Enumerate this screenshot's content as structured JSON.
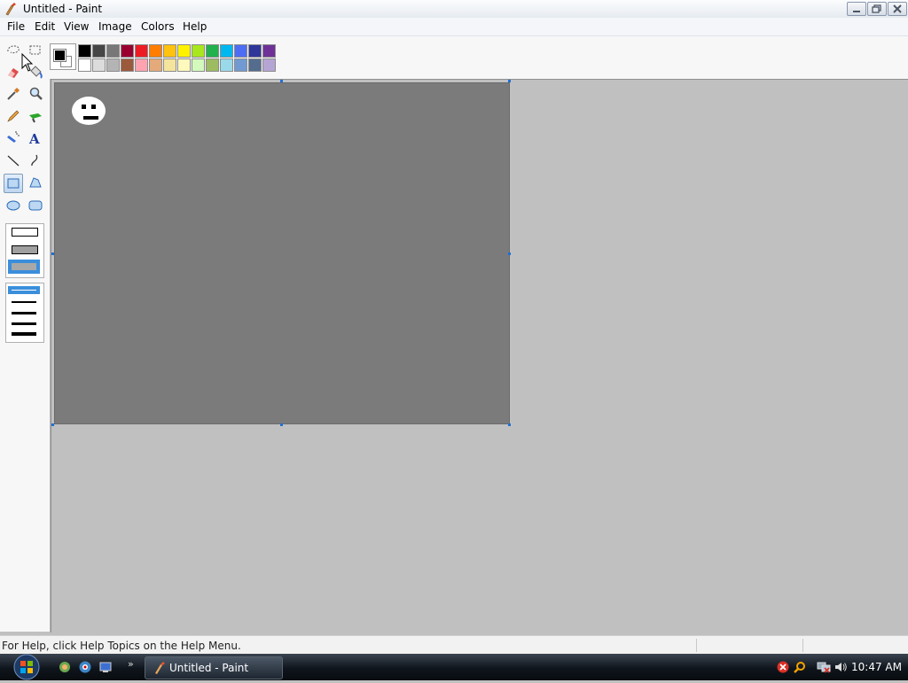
{
  "window": {
    "title": "Untitled - Paint"
  },
  "menu": {
    "items": [
      "File",
      "Edit",
      "View",
      "Image",
      "Colors",
      "Help"
    ]
  },
  "toolbox": {
    "tools": [
      "free-form-select",
      "select",
      "eraser",
      "fill-with-color",
      "pick-color",
      "magnifier",
      "pencil",
      "brush",
      "airbrush",
      "text",
      "line",
      "curve",
      "rectangle",
      "polygon",
      "ellipse",
      "rounded-rectangle"
    ],
    "selected_tool": "rectangle",
    "fill_styles": [
      "outline",
      "outline-and-fill",
      "fill"
    ],
    "selected_fill_style": "fill",
    "line_widths": [
      1,
      2,
      3,
      4,
      5
    ],
    "selected_line_width": 1
  },
  "palette": {
    "foreground": "#000000",
    "background": "#ffffff",
    "top_row": [
      "#000000",
      "#464646",
      "#787878",
      "#990030",
      "#ed1c24",
      "#ff7e00",
      "#ffc20e",
      "#fff200",
      "#a8e61d",
      "#22b14c",
      "#00b7ef",
      "#4d6df3",
      "#2f3699",
      "#6f3198"
    ],
    "bottom_row": [
      "#ffffff",
      "#dcdcdc",
      "#b4b4b4",
      "#9c5a3c",
      "#ffa3b1",
      "#e5aa7a",
      "#f5e49c",
      "#fff9bd",
      "#d3f9bc",
      "#9dbb61",
      "#99d9ea",
      "#709ad1",
      "#546d8e",
      "#b5a5d5"
    ]
  },
  "canvas": {
    "background": "#7b7b7b"
  },
  "status": {
    "message": "For Help, click Help Topics on the Help Menu."
  },
  "taskbar": {
    "task_label": "Untitled - Paint",
    "clock": "10:47 AM"
  }
}
